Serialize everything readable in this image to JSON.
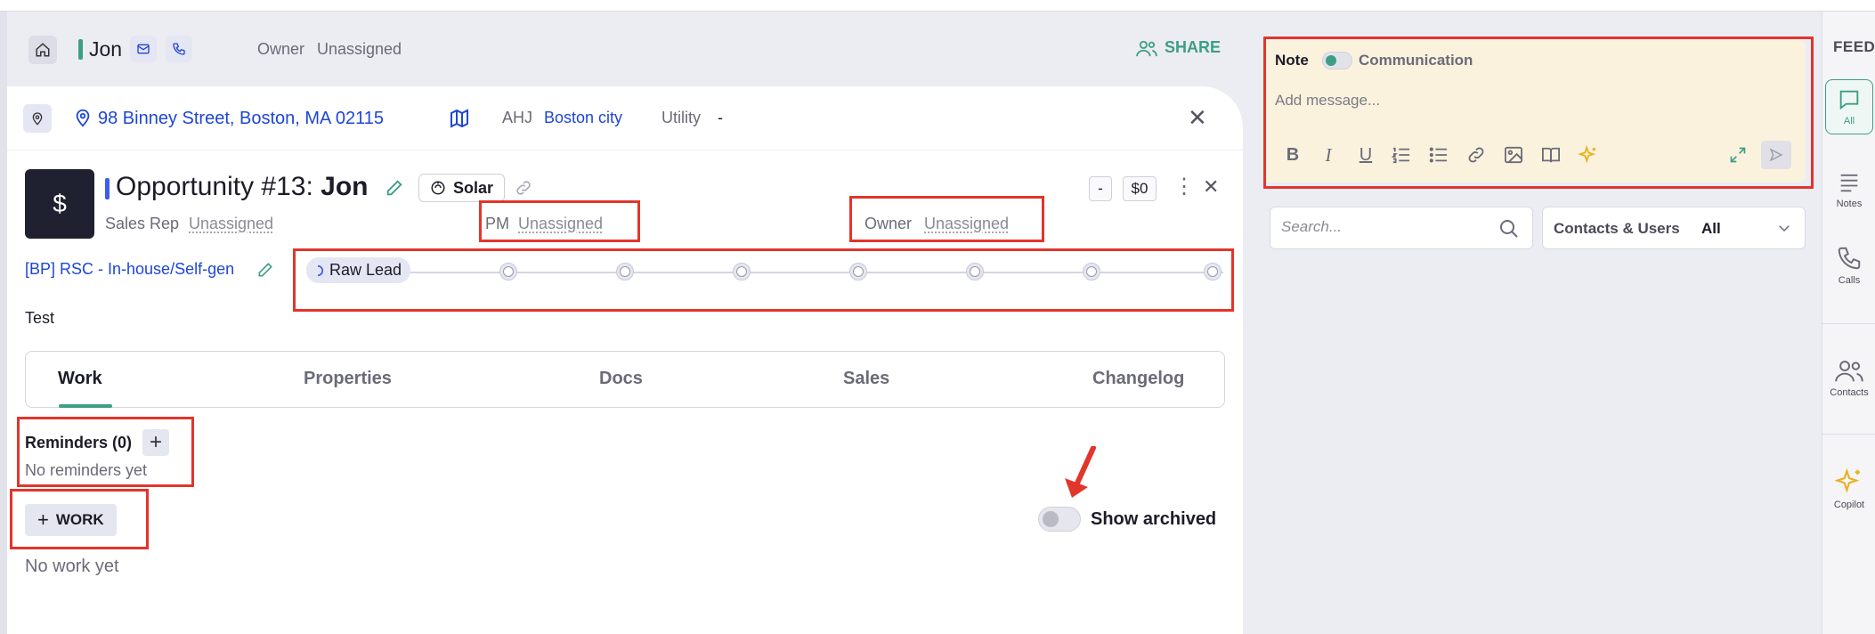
{
  "contact": {
    "name": "Jon",
    "owner_label": "Owner",
    "owner_value": "Unassigned",
    "share_label": "SHARE"
  },
  "address": {
    "text": "98 Binney Street, Boston, MA 02115",
    "ahj_label": "AHJ",
    "ahj_value": "Boston city",
    "utility_label": "Utility",
    "utility_value": "-"
  },
  "opportunity": {
    "icon_symbol": "$",
    "title_prefix": "Opportunity #13:",
    "title_name": "Jon",
    "type_chip": "Solar",
    "minus_label": "-",
    "amount": "$0",
    "sales_rep_label": "Sales Rep",
    "sales_rep_value": "Unassigned",
    "pm_label": "PM",
    "pm_value": "Unassigned",
    "owner_label": "Owner",
    "owner_value": "Unassigned",
    "pipeline": "[BP] RSC - In-house/Self-gen",
    "current_stage": "Raw Lead",
    "description": "Test"
  },
  "tabs": [
    {
      "label": "Work",
      "active": true
    },
    {
      "label": "Properties",
      "active": false
    },
    {
      "label": "Docs",
      "active": false
    },
    {
      "label": "Sales",
      "active": false
    },
    {
      "label": "Changelog",
      "active": false
    }
  ],
  "work": {
    "reminders_title": "Reminders (0)",
    "reminders_empty": "No reminders yet",
    "add_work_label": "WORK",
    "work_empty": "No work yet",
    "show_archived_label": "Show archived",
    "show_archived_on": false
  },
  "composer": {
    "note_label": "Note",
    "communication_label": "Communication",
    "placeholder": "Add message..."
  },
  "feed": {
    "search_placeholder": "Search...",
    "contacts_label": "Contacts & Users",
    "contacts_value": "All"
  },
  "sidebar": {
    "title": "FEED",
    "items": [
      {
        "label": "All",
        "icon": "chat-icon",
        "active": true
      },
      {
        "label": "Notes",
        "icon": "notes-icon",
        "active": false
      },
      {
        "label": "Calls",
        "icon": "phone-icon",
        "active": false
      },
      {
        "label": "Contacts",
        "icon": "contacts-icon",
        "active": false
      },
      {
        "label": "Copilot",
        "icon": "sparkle-icon",
        "active": false
      }
    ]
  },
  "colors": {
    "accent_green": "#3d9e86",
    "link_blue": "#1e46d6",
    "annotation_red": "#e2352b",
    "composer_bg": "#fbf2de"
  }
}
